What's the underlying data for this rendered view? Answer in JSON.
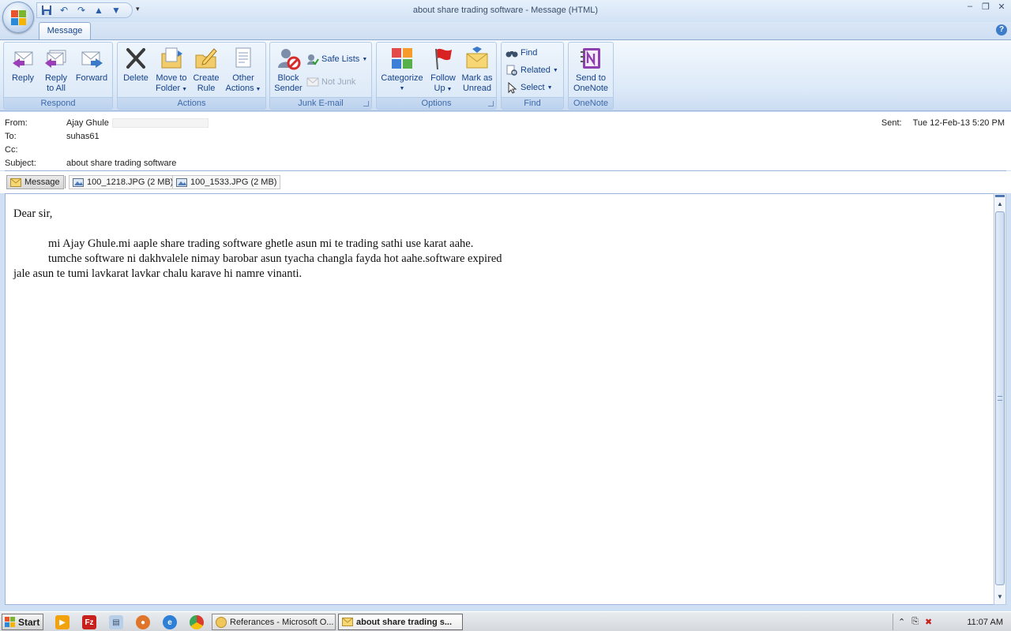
{
  "window": {
    "title": "about share trading software - Message (HTML)",
    "controls": [
      "–",
      "❐",
      "✕"
    ]
  },
  "tabs": [
    {
      "label": "Message"
    }
  ],
  "ribbon": {
    "groups": {
      "respond": "Respond",
      "actions": "Actions",
      "junk": "Junk E-mail",
      "options": "Options",
      "find": "Find",
      "onenote": "OneNote"
    },
    "reply": [
      "Reply",
      ""
    ],
    "reply_all": [
      "Reply",
      "to All"
    ],
    "forward": [
      "Forward",
      ""
    ],
    "delete": [
      "Delete",
      ""
    ],
    "move_to_folder": [
      "Move to",
      "Folder"
    ],
    "create_rule": [
      "Create",
      "Rule"
    ],
    "other_actions": [
      "Other",
      "Actions"
    ],
    "block_sender": [
      "Block",
      "Sender"
    ],
    "safe_lists": "Safe Lists",
    "not_junk": "Not Junk",
    "categorize": [
      "Categorize",
      ""
    ],
    "follow_up": [
      "Follow",
      "Up"
    ],
    "mark_unread": [
      "Mark as",
      "Unread"
    ],
    "find": "Find",
    "related": "Related",
    "select": "Select",
    "send_onenote": [
      "Send to",
      "OneNote"
    ]
  },
  "header": {
    "from_label": "From:",
    "from_value": "Ajay Ghule",
    "to_label": "To:",
    "to_value": "suhas61",
    "cc_label": "Cc:",
    "cc_value": "",
    "subject_label": "Subject:",
    "subject_value": "about share trading software",
    "sent_label": "Sent:",
    "sent_value": "Tue 12-Feb-13 5:20 PM"
  },
  "attachments": [
    {
      "label": "Message"
    },
    {
      "label": "100_1218.JPG (2 MB)"
    },
    {
      "label": "100_1533.JPG (2 MB)"
    }
  ],
  "body": {
    "greeting": "Dear sir,",
    "line1": "mi Ajay Ghule.mi aaple share trading software ghetle asun mi te trading sathi use karat aahe.",
    "line2": "tumche software ni dakhvalele nimay barobar asun tyacha changla fayda hot aahe.software expired",
    "line3": "jale asun te tumi lavkarat lavkar chalu karave hi namre vinanti."
  },
  "taskbar": {
    "start": "Start",
    "tasks": [
      {
        "label": "Referances - Microsoft O..."
      },
      {
        "label": "about share trading s..."
      }
    ],
    "clock": "11:07 AM"
  },
  "colors": {
    "ribbon_text": "#15428b",
    "group_label": "#3e6aaa",
    "accent": "#3d7cc9"
  }
}
